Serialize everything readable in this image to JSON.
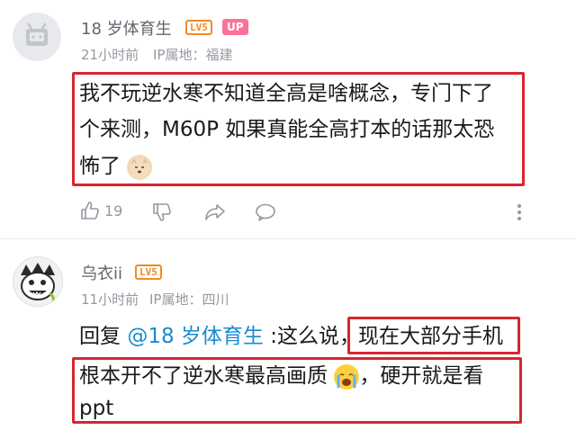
{
  "comments": [
    {
      "username": "18 岁体育生",
      "level_badge": "LV5",
      "up_badge": "UP",
      "time": "21小时前",
      "ip_label": "IP属地：福建",
      "content_line1": "我不玩逆水寒不知道全高是啥概念，专门下了",
      "content_line2": "个来测，M60P 如果真能全高打本的话那太恐",
      "content_line3": "怖了",
      "emoji": "dog-emoji",
      "like_count": "19"
    },
    {
      "username": "乌衣ii",
      "level_badge": "LV5",
      "time": "11小时前",
      "ip_label": "IP属地：四川",
      "reply_prefix": "回复 ",
      "mention": "@18 岁体育生",
      "reply_mid": " :这么说，",
      "reply_highlight": "现在大部分手机",
      "content_line2": "根本开不了逆水寒最高画质",
      "content_line2_tail": "，硬开就是看",
      "content_line3": "ppt",
      "emoji": "crying-emoji"
    }
  ],
  "colors": {
    "highlight_border": "#d8252f",
    "level_badge": "#f28a23",
    "up_badge": "#fb7299",
    "mention": "#178bcf"
  }
}
